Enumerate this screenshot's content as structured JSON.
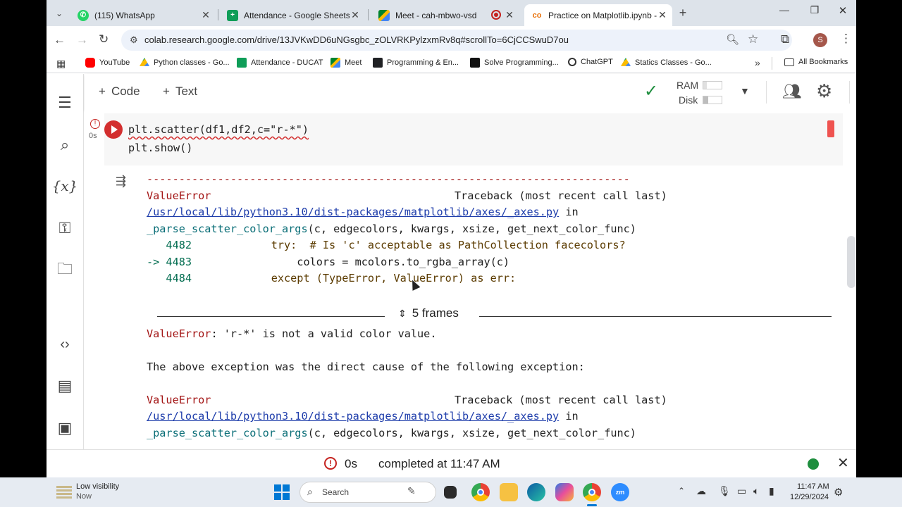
{
  "tabs": [
    {
      "title": "(115) WhatsApp",
      "icon": "whatsapp-icon"
    },
    {
      "title": "Attendance - Google Sheets",
      "icon": "sheets-icon"
    },
    {
      "title": "Meet - cah-mbwo-vsd",
      "icon": "meet-icon"
    },
    {
      "title": "Practice on Matplotlib.ipynb - C",
      "icon": "colab-icon"
    }
  ],
  "address": {
    "url": "colab.research.google.com/drive/13JVKwDD6uNGsgbc_zOLVRKPylzxmRv8q#scrollTo=6CjCCSwuD7ou"
  },
  "profile_initial": "S",
  "bookmarks": [
    {
      "label": "YouTube",
      "icon": "youtube-icon"
    },
    {
      "label": "Python classes - Go...",
      "icon": "drive-icon"
    },
    {
      "label": "Attendance - DUCAT",
      "icon": "sheets-icon"
    },
    {
      "label": "Meet",
      "icon": "meet-icon"
    },
    {
      "label": "Programming & En...",
      "icon": "bookmark-page-icon"
    },
    {
      "label": "Solve Programming...",
      "icon": "bookmark-page-icon"
    },
    {
      "label": "ChatGPT",
      "icon": "chatgpt-icon"
    },
    {
      "label": "Statics Classes - Go...",
      "icon": "drive-icon"
    },
    {
      "label": "All Bookmarks",
      "icon": "folder-icon"
    }
  ],
  "colab": {
    "add_code": "Code",
    "add_text": "Text",
    "ram_label": "RAM",
    "disk_label": "Disk",
    "exec_time": "0s",
    "code_lines": [
      "plt.scatter(df1,df2,c=\"r-*\")",
      "plt.show()"
    ],
    "output": {
      "dashes": "---------------------------------------------------------------------------",
      "err1_name": "ValueError",
      "err1_tb": "Traceback (most recent call last)",
      "path1": "/usr/local/lib/python3.10/dist-packages/matplotlib/axes/_axes.py",
      "path1_in": " in",
      "func1": "_parse_scatter_color_args",
      "func1_args": "(c, edgecolors, kwargs, xsize, get_next_color_func)",
      "line_4482_no": "   4482",
      "line_4482_code": "            try:  # Is 'c' acceptable as PathCollection facecolors?",
      "line_4483_no": "-> 4483",
      "line_4483_code": "                colors = mcolors.to_rgba_array(c)",
      "line_4484_no": "   4484",
      "line_4484_code": "            except (TypeError, ValueError) as err:",
      "frames": "5 frames",
      "err_msg_name": "ValueError",
      "err_msg": ": 'r-*' is not a valid color value.",
      "cause": "The above exception was the direct cause of the following exception:",
      "err2_name": "ValueError",
      "err2_tb": "Traceback (most recent call last)",
      "path2": "/usr/local/lib/python3.10/dist-packages/matplotlib/axes/_axes.py",
      "path2_in": " in",
      "func2": "_parse_scatter_color_args",
      "func2_args": "(c, edgecolors, kwargs, xsize, get_next_color_func)"
    },
    "status": {
      "time": "0s",
      "completed": "completed at 11:47 AM"
    }
  },
  "taskbar": {
    "weather_title": "Low visibility",
    "weather_sub": "Now",
    "search_placeholder": "Search",
    "clock_time": "11:47 AM",
    "clock_date": "12/29/2024"
  },
  "colors": {
    "accent_green": "#1e8e3e",
    "run_red": "#d32f2f",
    "error_red": "#a31515",
    "link_blue": "#1e3dab"
  }
}
